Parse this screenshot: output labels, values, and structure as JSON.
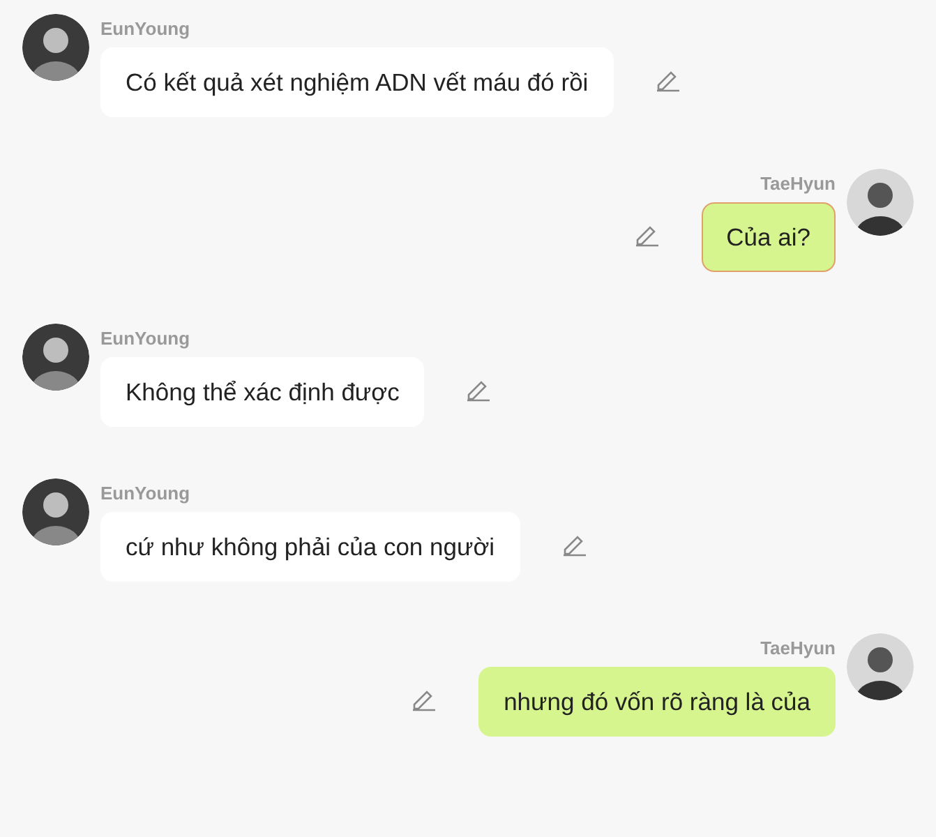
{
  "messages": [
    {
      "kind": "incoming",
      "sender": "EunYoung",
      "text": "Có kết quả xét nghiệm ADN vết máu đó rồi",
      "selected": false
    },
    {
      "kind": "outgoing",
      "sender": "TaeHyun",
      "text": "Của ai?",
      "selected": true
    },
    {
      "kind": "incoming",
      "sender": "EunYoung",
      "text": "Không thể xác định được",
      "selected": false
    },
    {
      "kind": "incoming",
      "sender": "EunYoung",
      "text": "cứ như không phải của con người",
      "selected": false
    },
    {
      "kind": "outgoing",
      "sender": "TaeHyun",
      "text": "nhưng đó vốn rõ ràng là của",
      "selected": false
    }
  ]
}
